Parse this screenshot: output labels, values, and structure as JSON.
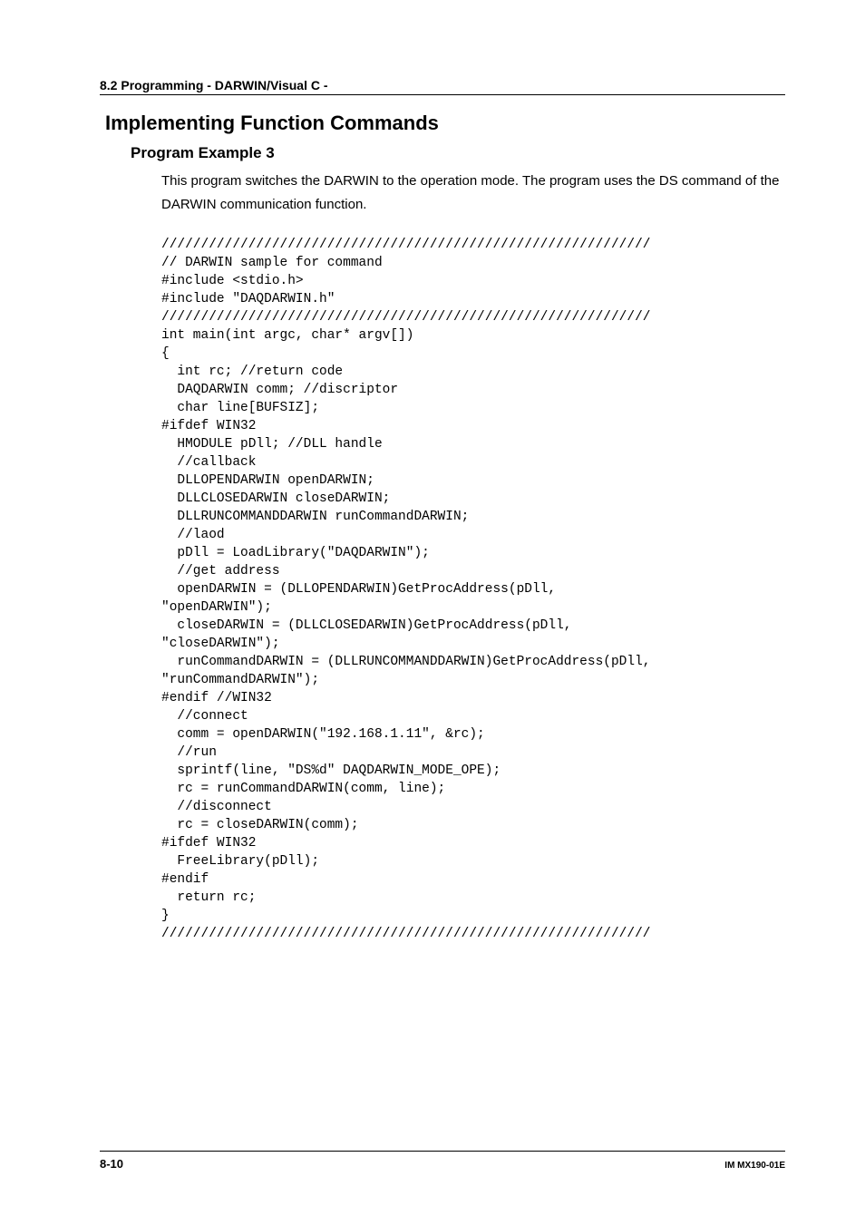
{
  "header": {
    "section": "8.2  Programming - DARWIN/Visual C -"
  },
  "headings": {
    "main": "Implementing Function Commands",
    "sub": "Program Example 3"
  },
  "description": "This program switches the DARWIN to the operation mode. The program uses the DS command of the DARWIN communication function.",
  "code": "//////////////////////////////////////////////////////////////\n// DARWIN sample for command\n#include <stdio.h>\n#include \"DAQDARWIN.h\"\n//////////////////////////////////////////////////////////////\nint main(int argc, char* argv[])\n{\n  int rc; //return code\n  DAQDARWIN comm; //discriptor\n  char line[BUFSIZ];\n#ifdef WIN32\n  HMODULE pDll; //DLL handle\n  //callback\n  DLLOPENDARWIN openDARWIN;\n  DLLCLOSEDARWIN closeDARWIN;\n  DLLRUNCOMMANDDARWIN runCommandDARWIN;\n  //laod\n  pDll = LoadLibrary(\"DAQDARWIN\");\n  //get address\n  openDARWIN = (DLLOPENDARWIN)GetProcAddress(pDll,\n\"openDARWIN\");\n  closeDARWIN = (DLLCLOSEDARWIN)GetProcAddress(pDll,\n\"closeDARWIN\");\n  runCommandDARWIN = (DLLRUNCOMMANDDARWIN)GetProcAddress(pDll,\n\"runCommandDARWIN\");\n#endif //WIN32\n  //connect\n  comm = openDARWIN(\"192.168.1.11\", &rc);\n  //run\n  sprintf(line, \"DS%d\" DAQDARWIN_MODE_OPE);\n  rc = runCommandDARWIN(comm, line);\n  //disconnect\n  rc = closeDARWIN(comm);\n#ifdef WIN32\n  FreeLibrary(pDll);\n#endif\n  return rc;\n}\n//////////////////////////////////////////////////////////////",
  "footer": {
    "page": "8-10",
    "docId": "IM MX190-01E"
  }
}
